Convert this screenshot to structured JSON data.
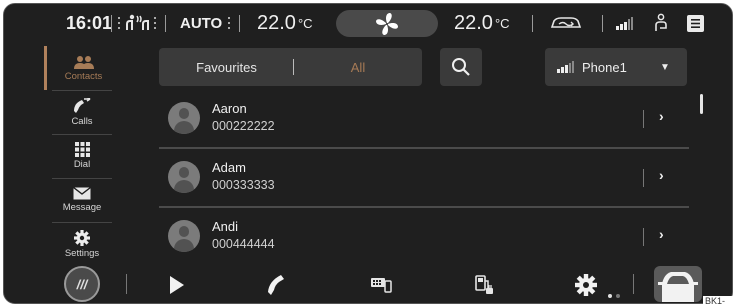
{
  "status_bar": {
    "time": "16:01",
    "climate_mode": "AUTO",
    "temp_left": "22.0",
    "temp_left_unit": "°C",
    "temp_right": "22.0",
    "temp_right_unit": "°C",
    "icons": [
      "seat-airflow-icon",
      "fan-icon",
      "car-ventilation-icon",
      "signal-strength-icon",
      "person-seat-icon",
      "menu-icon"
    ]
  },
  "sidebar": {
    "items": [
      {
        "label": "Contacts",
        "icon": "contacts-icon",
        "active": true
      },
      {
        "label": "Calls",
        "icon": "phone-icon",
        "active": false
      },
      {
        "label": "Dial",
        "icon": "keypad-icon",
        "active": false
      },
      {
        "label": "Message",
        "icon": "envelope-icon",
        "active": false
      },
      {
        "label": "Settings",
        "icon": "gear-icon",
        "active": false
      }
    ]
  },
  "tabs": {
    "favourites": "Favourites",
    "all": "All",
    "selected": "All"
  },
  "phone_selector": {
    "value": "Phone1",
    "icon": "signal-strength-icon"
  },
  "contacts": [
    {
      "name": "Aaron",
      "number": "000222222"
    },
    {
      "name": "Adam",
      "number": "000333333"
    },
    {
      "name": "Andi",
      "number": "000444444"
    }
  ],
  "bottom_bar": {
    "home_label": "///",
    "icons": [
      "play-icon",
      "phone-icon",
      "car-phone-icon",
      "fuel-icon",
      "gear-icon",
      "car-icon"
    ]
  },
  "figure_code": "BK1-0093",
  "colors": {
    "background": "#1f1f1f",
    "panel": "#3a3a3a",
    "accent": "#a67a55",
    "text": "#f0f0f0"
  }
}
